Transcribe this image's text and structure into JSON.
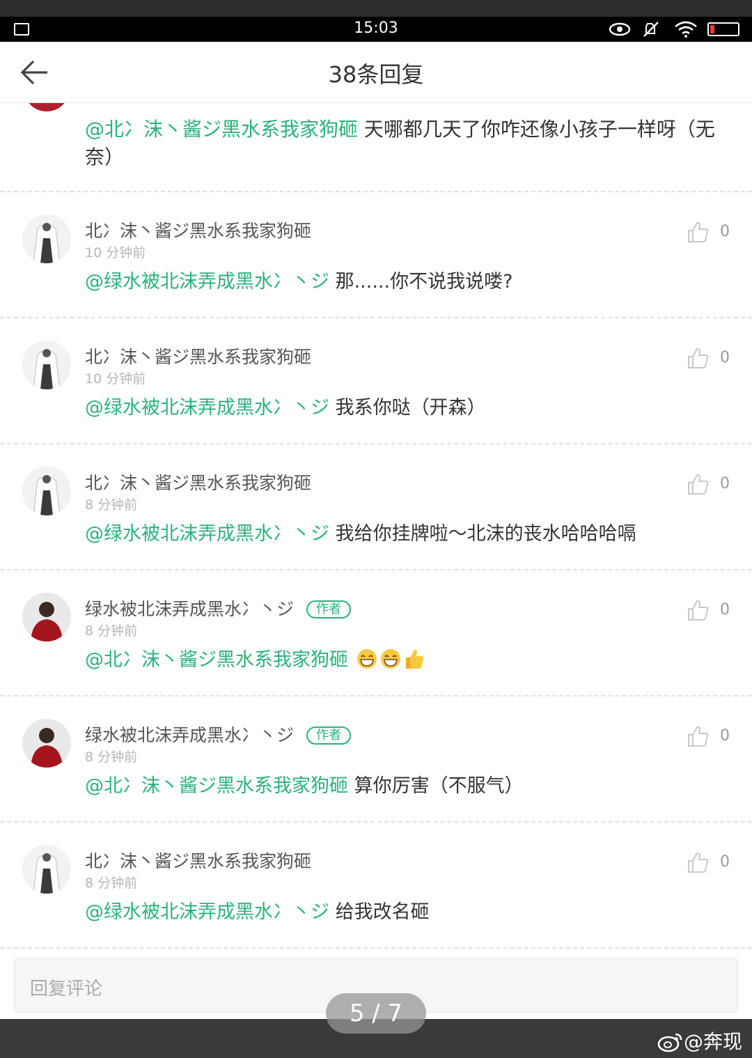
{
  "status_bar": {
    "time": "15:03"
  },
  "header": {
    "title": "38条回复"
  },
  "partial_comment": {
    "mention": "@北冫沫丶酱ジ黑水系我家狗砸",
    "text": " 天哪都几天了你咋还像小孩子一样呀（无奈）"
  },
  "comments": [
    {
      "user": "北冫沫丶酱ジ黑水系我家狗砸",
      "is_author": false,
      "time": "10 分钟前",
      "mention": "@绿水被北沫弄成黑水冫丶ジ",
      "text": " 那......你不说我说喽?",
      "likes": "0"
    },
    {
      "user": "北冫沫丶酱ジ黑水系我家狗砸",
      "is_author": false,
      "time": "10 分钟前",
      "mention": "@绿水被北沫弄成黑水冫丶ジ",
      "text": " 我系你哒（开森）",
      "likes": "0"
    },
    {
      "user": "北冫沫丶酱ジ黑水系我家狗砸",
      "is_author": false,
      "time": "8 分钟前",
      "mention": "@绿水被北沫弄成黑水冫丶ジ",
      "text": " 我给你挂牌啦～北沫的丧水哈哈哈嗝",
      "likes": "0"
    },
    {
      "user": "绿水被北沫弄成黑水冫丶ジ",
      "is_author": true,
      "badge": "作者",
      "time": "8 分钟前",
      "mention": "@北冫沫丶酱ジ黑水系我家狗砸",
      "text": " ",
      "likes": "0"
    },
    {
      "user": "绿水被北沫弄成黑水冫丶ジ",
      "is_author": true,
      "badge": "作者",
      "time": "8 分钟前",
      "mention": "@北冫沫丶酱ジ黑水系我家狗砸",
      "text": " 算你厉害（不服气）",
      "likes": "0"
    },
    {
      "user": "北冫沫丶酱ジ黑水系我家狗砸",
      "is_author": false,
      "time": "8 分钟前",
      "mention": "@绿水被北沫弄成黑水冫丶ジ",
      "text": " 给我改名砸",
      "likes": "0"
    }
  ],
  "reply_input": {
    "placeholder": "回复评论"
  },
  "pager": {
    "label": "5 / 7"
  },
  "watermark": {
    "text": "@奔现"
  },
  "colors": {
    "accent": "#2ab27b",
    "text": "#333333",
    "muted": "#b5b5b5"
  }
}
